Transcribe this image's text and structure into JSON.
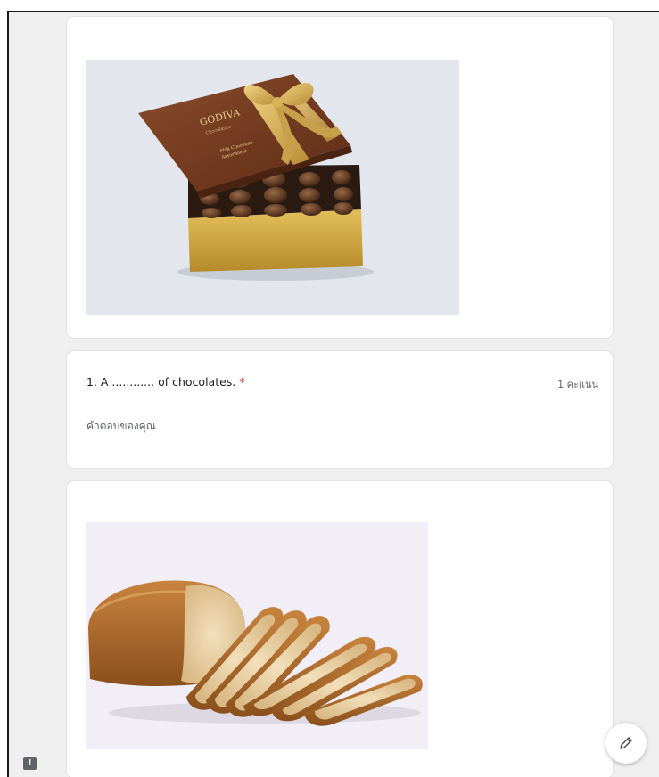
{
  "form": {
    "questions": [
      {
        "number_text": "1. A ............ of chocolates.",
        "required_mark": "*",
        "points": "1 คะแนน",
        "answer_placeholder": "คำตอบของคุณ"
      }
    ]
  },
  "images": {
    "chocolates": {
      "icon": "chocolate-box-image",
      "brand_text": "GODIVA",
      "brand_sub": "Chocolatier",
      "label_line1": "Milk Chocolate",
      "label_line2": "Assortment"
    },
    "bread": {
      "icon": "sliced-bread-image"
    }
  },
  "controls": {
    "feedback_icon": "report-feedback-icon",
    "feedback_glyph": "!",
    "edit_icon": "pencil-icon"
  },
  "colors": {
    "page_background": "#efefef",
    "card_background": "#ffffff",
    "required": "#d93025",
    "secondary_text": "#5f6368"
  }
}
